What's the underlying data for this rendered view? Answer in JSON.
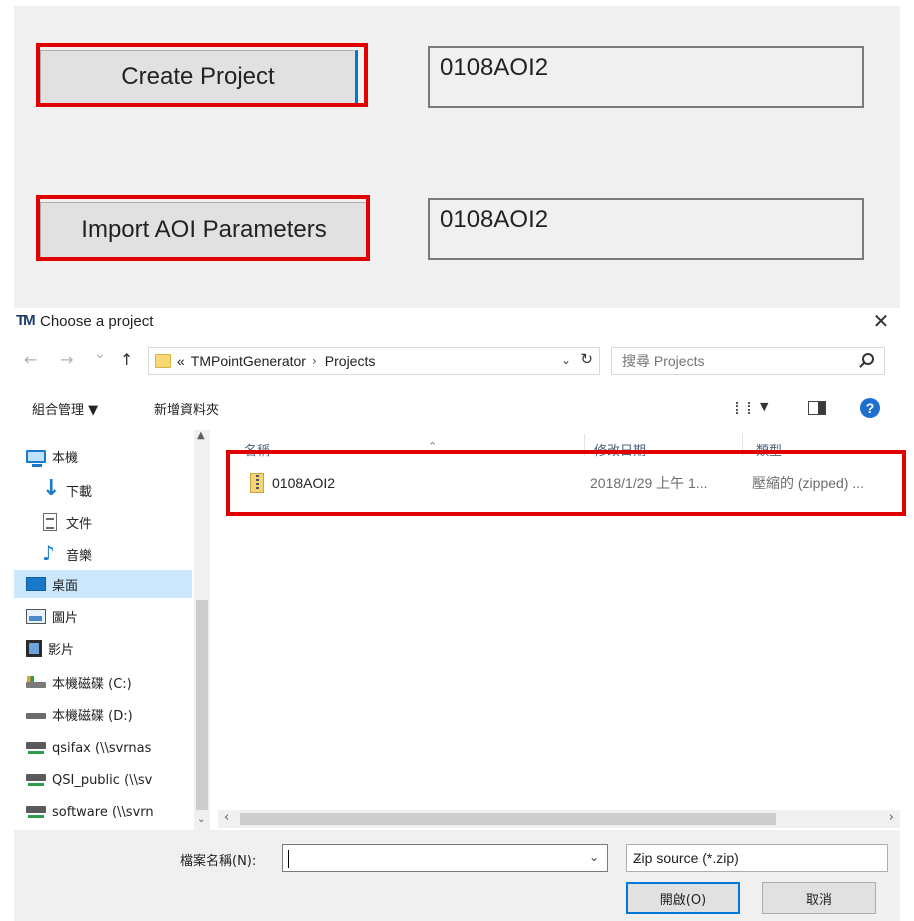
{
  "app": {
    "create_project_label": "Create Project",
    "create_project_value": "0108AOI2",
    "import_aoi_label": "Import AOI Parameters",
    "import_aoi_value": "0108AOI2"
  },
  "dialog": {
    "title": "Choose a project",
    "logo_text": "TM",
    "close_glyph": "✕",
    "nav": {
      "back": "←",
      "forward": "→",
      "recent": "⌄",
      "up": "↑",
      "breadcrumb_prefix": "«",
      "breadcrumb": [
        "TMPointGenerator",
        "Projects"
      ],
      "breadcrumb_sep": "›",
      "dropdown": "⌄",
      "refresh": "↻",
      "search_placeholder": "搜尋 Projects"
    },
    "toolbar": {
      "organize": "組合管理 ▼",
      "new_folder": "新增資料夾",
      "view_drop": "▼",
      "help": "?"
    },
    "sidebar": {
      "items": [
        {
          "label": "本機",
          "icon": "computer-icon"
        },
        {
          "label": "下載",
          "icon": "download-icon"
        },
        {
          "label": "文件",
          "icon": "document-icon"
        },
        {
          "label": "音樂",
          "icon": "music-icon"
        },
        {
          "label": "桌面",
          "icon": "desktop-icon"
        },
        {
          "label": "圖片",
          "icon": "pictures-icon"
        },
        {
          "label": "影片",
          "icon": "videos-icon"
        },
        {
          "label": "本機磁碟 (C:)",
          "icon": "drive-c-icon"
        },
        {
          "label": "本機磁碟 (D:)",
          "icon": "drive-d-icon"
        },
        {
          "label": "qsifax (\\\\svrnas",
          "icon": "network-drive-icon"
        },
        {
          "label": "QSI_public (\\\\sv",
          "icon": "network-drive-icon"
        },
        {
          "label": "software (\\\\svrn",
          "icon": "network-drive-icon"
        }
      ],
      "scroll_up": "▲",
      "scroll_down": "⌄"
    },
    "columns": {
      "name": "名稱",
      "modified": "修改日期",
      "type": "類型",
      "sort_arrow": "⌃"
    },
    "files": [
      {
        "name": "0108AOI2",
        "modified": "2018/1/29 上午 1...",
        "type": "壓縮的 (zipped) ..."
      }
    ],
    "hscroll": {
      "left": "‹",
      "right": "›"
    },
    "bottom": {
      "filename_label": "檔案名稱(N):",
      "filename_value": "",
      "filename_drop": "⌄",
      "filter_value": "Zip source (*.zip)",
      "filter_drop": "⌄",
      "open_label": "開啟(O)",
      "cancel_label": "取消"
    }
  }
}
